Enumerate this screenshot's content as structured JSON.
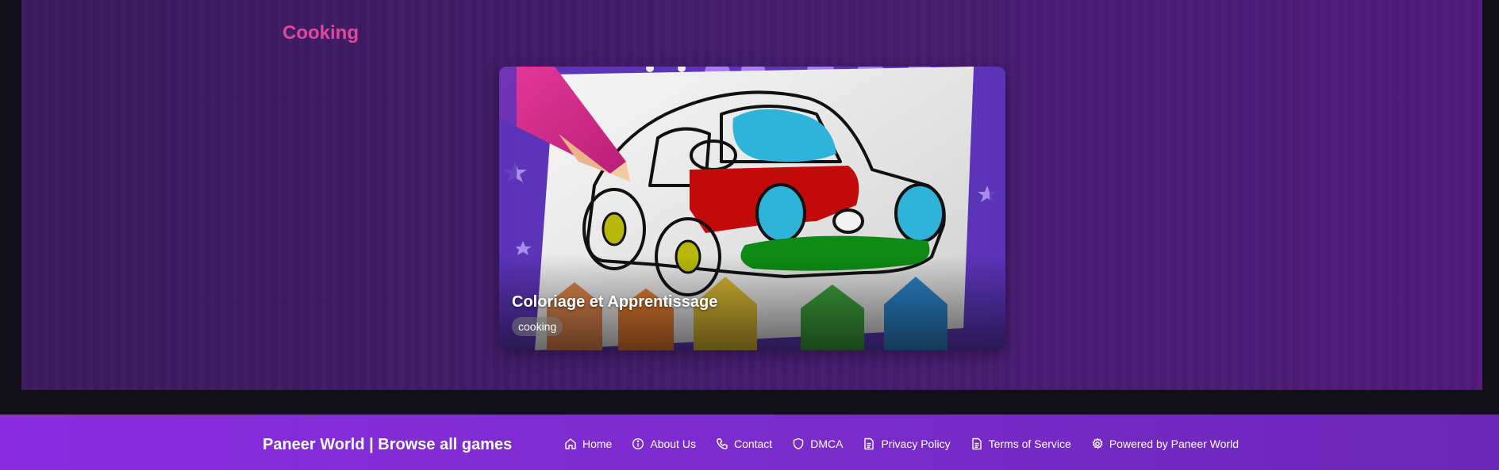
{
  "section": {
    "title": "Cooking"
  },
  "game_card": {
    "title": "Coloriage et Apprentissage",
    "tag": "cooking",
    "image_icon": "car-coloring-thumbnail"
  },
  "footer": {
    "brand": "Paneer World | Browse all games",
    "links": [
      {
        "label": "Home",
        "icon": "home-icon"
      },
      {
        "label": "About Us",
        "icon": "info-icon"
      },
      {
        "label": "Contact",
        "icon": "phone-icon"
      },
      {
        "label": "DMCA",
        "icon": "shield-icon"
      },
      {
        "label": "Privacy Policy",
        "icon": "document-icon"
      },
      {
        "label": "Terms of Service",
        "icon": "document-icon"
      },
      {
        "label": "Powered by Paneer World",
        "icon": "gear-icon"
      }
    ]
  },
  "colors": {
    "section_title": "#e0489a",
    "footer_bg": "#8a2be2",
    "page_bg": "#111019",
    "panel_bg": "#421c6b"
  }
}
